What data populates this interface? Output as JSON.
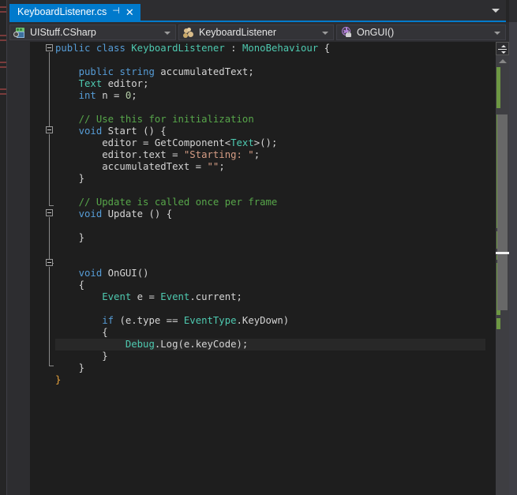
{
  "window": {
    "theme": "visual-studio-dark",
    "accent_color": "#007acc",
    "editor_bg": "#1e1e1e",
    "chrome_bg": "#2d2d30"
  },
  "tabbar": {
    "active_tab": {
      "title": "KeyboardListener.cs",
      "pin_icon": "pin-icon",
      "close_icon": "close-icon",
      "pin_glyph": "⊣",
      "close_glyph": "✕"
    },
    "overflow_icon": "chevron-down-icon"
  },
  "navbar": {
    "project_dropdown": {
      "value": "UIStuff.CSharp",
      "icon": "project-icon"
    },
    "type_dropdown": {
      "value": "KeyboardListener",
      "icon": "class-icon"
    },
    "member_dropdown": {
      "value": "OnGUI()",
      "icon": "method-private-icon"
    }
  },
  "editor": {
    "language": "csharp",
    "file_name": "KeyboardListener.cs",
    "current_line_number": 25,
    "current_line_text": "Debug.Log(e.keyCode);",
    "colors": {
      "keyword": "#569cd6",
      "type": "#4ec9b0",
      "comment": "#57a64a",
      "string": "#d69d85",
      "number": "#b5cea8",
      "plain": "#d4d4d4",
      "change_bar": "#6d9843",
      "current_line_bg": "#282828"
    },
    "code_lines": [
      {
        "n": 1,
        "segments": [
          {
            "t": "public",
            "c": "k"
          },
          {
            "t": " ",
            "c": "p"
          },
          {
            "t": "class",
            "c": "k"
          },
          {
            "t": " ",
            "c": "p"
          },
          {
            "t": "KeyboardListener",
            "c": "t"
          },
          {
            "t": " : ",
            "c": "p"
          },
          {
            "t": "MonoBehaviour",
            "c": "t"
          },
          {
            "t": " {",
            "c": "p"
          }
        ]
      },
      {
        "n": 2,
        "segments": []
      },
      {
        "n": 3,
        "segments": [
          {
            "t": "    ",
            "c": "p"
          },
          {
            "t": "public",
            "c": "k"
          },
          {
            "t": " ",
            "c": "p"
          },
          {
            "t": "string",
            "c": "k"
          },
          {
            "t": " accumulatedText;",
            "c": "p"
          }
        ]
      },
      {
        "n": 4,
        "segments": [
          {
            "t": "    ",
            "c": "p"
          },
          {
            "t": "Text",
            "c": "t"
          },
          {
            "t": " editor;",
            "c": "p"
          }
        ]
      },
      {
        "n": 5,
        "segments": [
          {
            "t": "    ",
            "c": "p"
          },
          {
            "t": "int",
            "c": "k"
          },
          {
            "t": " n = ",
            "c": "p"
          },
          {
            "t": "0",
            "c": "n"
          },
          {
            "t": ";",
            "c": "p"
          }
        ]
      },
      {
        "n": 6,
        "segments": []
      },
      {
        "n": 7,
        "segments": [
          {
            "t": "    ",
            "c": "p"
          },
          {
            "t": "// Use this for initialization",
            "c": "cm"
          }
        ]
      },
      {
        "n": 8,
        "segments": [
          {
            "t": "    ",
            "c": "p"
          },
          {
            "t": "void",
            "c": "k"
          },
          {
            "t": " ",
            "c": "p"
          },
          {
            "t": "Start",
            "c": "p"
          },
          {
            "t": " () {",
            "c": "p"
          }
        ]
      },
      {
        "n": 9,
        "segments": [
          {
            "t": "        editor = ",
            "c": "p"
          },
          {
            "t": "GetComponent",
            "c": "p"
          },
          {
            "t": "<",
            "c": "p"
          },
          {
            "t": "Text",
            "c": "t"
          },
          {
            "t": ">();",
            "c": "p"
          }
        ]
      },
      {
        "n": 10,
        "segments": [
          {
            "t": "        editor.text = ",
            "c": "p"
          },
          {
            "t": "\"Starting: \"",
            "c": "s"
          },
          {
            "t": ";",
            "c": "p"
          }
        ]
      },
      {
        "n": 11,
        "segments": [
          {
            "t": "        accumulatedText = ",
            "c": "p"
          },
          {
            "t": "\"\"",
            "c": "s"
          },
          {
            "t": ";",
            "c": "p"
          }
        ]
      },
      {
        "n": 12,
        "segments": [
          {
            "t": "    }",
            "c": "p"
          }
        ]
      },
      {
        "n": 13,
        "segments": []
      },
      {
        "n": 14,
        "segments": [
          {
            "t": "    ",
            "c": "p"
          },
          {
            "t": "// Update is called once per frame",
            "c": "cm"
          }
        ]
      },
      {
        "n": 15,
        "segments": [
          {
            "t": "    ",
            "c": "p"
          },
          {
            "t": "void",
            "c": "k"
          },
          {
            "t": " ",
            "c": "p"
          },
          {
            "t": "Update",
            "c": "p"
          },
          {
            "t": " () {",
            "c": "p"
          }
        ]
      },
      {
        "n": 16,
        "segments": []
      },
      {
        "n": 17,
        "segments": [
          {
            "t": "    }",
            "c": "p"
          }
        ]
      },
      {
        "n": 18,
        "segments": []
      },
      {
        "n": 19,
        "segments": []
      },
      {
        "n": 20,
        "segments": [
          {
            "t": "    ",
            "c": "p"
          },
          {
            "t": "void",
            "c": "k"
          },
          {
            "t": " ",
            "c": "p"
          },
          {
            "t": "OnGUI",
            "c": "p"
          },
          {
            "t": "()",
            "c": "p"
          }
        ]
      },
      {
        "n": 21,
        "segments": [
          {
            "t": "    {",
            "c": "p"
          }
        ]
      },
      {
        "n": 22,
        "segments": [
          {
            "t": "        ",
            "c": "p"
          },
          {
            "t": "Event",
            "c": "t"
          },
          {
            "t": " e = ",
            "c": "p"
          },
          {
            "t": "Event",
            "c": "t"
          },
          {
            "t": ".current;",
            "c": "p"
          }
        ]
      },
      {
        "n": 23,
        "segments": []
      },
      {
        "n": 24,
        "segments": [
          {
            "t": "        ",
            "c": "p"
          },
          {
            "t": "if",
            "c": "k"
          },
          {
            "t": " (e.type == ",
            "c": "p"
          },
          {
            "t": "EventType",
            "c": "t"
          },
          {
            "t": ".KeyDown)",
            "c": "p"
          }
        ]
      },
      {
        "n": 25,
        "segments": [
          {
            "t": "        {",
            "c": "p"
          }
        ]
      },
      {
        "n": 26,
        "segments": [
          {
            "t": "            ",
            "c": "p"
          },
          {
            "t": "Debug",
            "c": "t"
          },
          {
            "t": ".Log(e.keyCode);",
            "c": "p"
          }
        ]
      },
      {
        "n": 27,
        "segments": [
          {
            "t": "        }",
            "c": "p"
          }
        ]
      },
      {
        "n": 28,
        "segments": [
          {
            "t": "    }",
            "c": "p"
          }
        ]
      },
      {
        "n": 29,
        "segments": [
          {
            "t": "}",
            "c": "brg"
          }
        ]
      }
    ]
  },
  "scrollbar": {
    "split_view_icon": "split-view-icon",
    "scroll_up_icon": "triangle-up-icon",
    "has_change_markers": true,
    "has_caret_marker": true
  }
}
